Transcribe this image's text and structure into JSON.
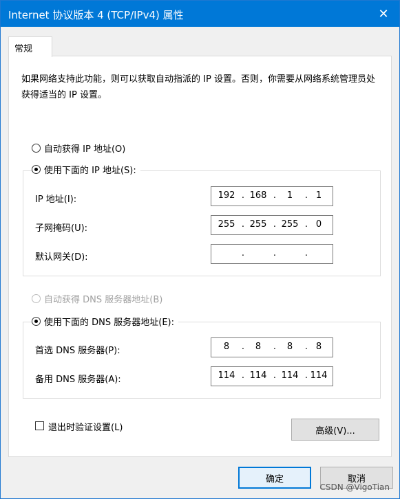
{
  "window": {
    "title": "Internet 协议版本 4 (TCP/IPv4) 属性",
    "close_glyph": "✕"
  },
  "tab": {
    "label": "常规"
  },
  "description": "如果网络支持此功能，则可以获取自动指派的 IP 设置。否则，你需要从网络系统管理员处获得适当的 IP 设置。",
  "ip_section": {
    "auto_label": "自动获得 IP 地址(O)",
    "manual_label": "使用下面的 IP 地址(S):",
    "fields": [
      {
        "label": "IP 地址(I):",
        "octets": [
          "192",
          "168",
          "1",
          "1"
        ]
      },
      {
        "label": "子网掩码(U):",
        "octets": [
          "255",
          "255",
          "255",
          "0"
        ]
      },
      {
        "label": "默认网关(D):",
        "octets": [
          "",
          "",
          "",
          ""
        ]
      }
    ]
  },
  "dns_section": {
    "auto_label": "自动获得 DNS 服务器地址(B)",
    "manual_label": "使用下面的 DNS 服务器地址(E):",
    "fields": [
      {
        "label": "首选 DNS 服务器(P):",
        "octets": [
          "8",
          "8",
          "8",
          "8"
        ]
      },
      {
        "label": "备用 DNS 服务器(A):",
        "octets": [
          "114",
          "114",
          "114",
          "114"
        ]
      }
    ]
  },
  "validate_label": "退出时验证设置(L)",
  "advanced_label": "高级(V)...",
  "ok_label": "确定",
  "cancel_label": "取消",
  "watermark": "CSDN @VigoTian",
  "colors": {
    "titlebar": "#0078d7",
    "default_button_border": "#0078d7"
  }
}
